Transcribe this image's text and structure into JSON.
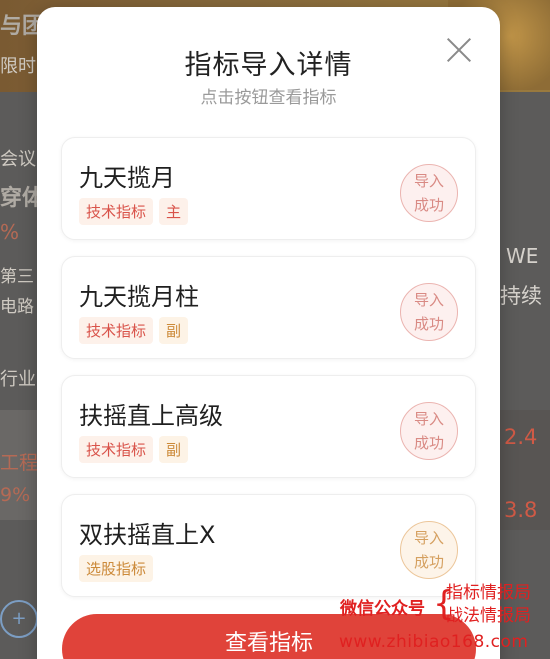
{
  "background": {
    "texts": [
      "与团",
      "限时",
      "会议",
      "穿体",
      "%",
      "第三",
      "电路",
      "行业",
      "工程",
      "9%",
      "WE",
      "持续",
      "2.4",
      "3.8"
    ]
  },
  "modal": {
    "title": "指标导入详情",
    "subtitle": "点击按钮查看指标",
    "close_icon": "close-icon",
    "items": [
      {
        "name": "九天揽月",
        "tags": [
          "技术指标",
          "主"
        ],
        "status_line1": "导入",
        "status_line2": "成功",
        "stamp_color": "#d98a84"
      },
      {
        "name": "九天揽月柱",
        "tags": [
          "技术指标",
          "副"
        ],
        "status_line1": "导入",
        "status_line2": "成功",
        "stamp_color": "#d98a84"
      },
      {
        "name": "扶摇直上高级",
        "tags": [
          "技术指标",
          "副"
        ],
        "status_line1": "导入",
        "status_line2": "成功",
        "stamp_color": "#d98a84"
      },
      {
        "name": "双扶摇直上X",
        "tags": [
          "选股指标"
        ],
        "status_line1": "导入",
        "status_line2": "成功",
        "stamp_color": "#d5a060"
      }
    ],
    "button_label": "查看指标"
  },
  "watermark": {
    "left": "微信公众号",
    "right_line1": "指标情报局",
    "right_line2": "战法情报局",
    "url": "www.zhibiao168.com"
  },
  "colors": {
    "accent": "#e0433a",
    "success_stamp": "#d98a84",
    "tag_red": "#d9534a",
    "tag_gold": "#cc8a3a"
  }
}
